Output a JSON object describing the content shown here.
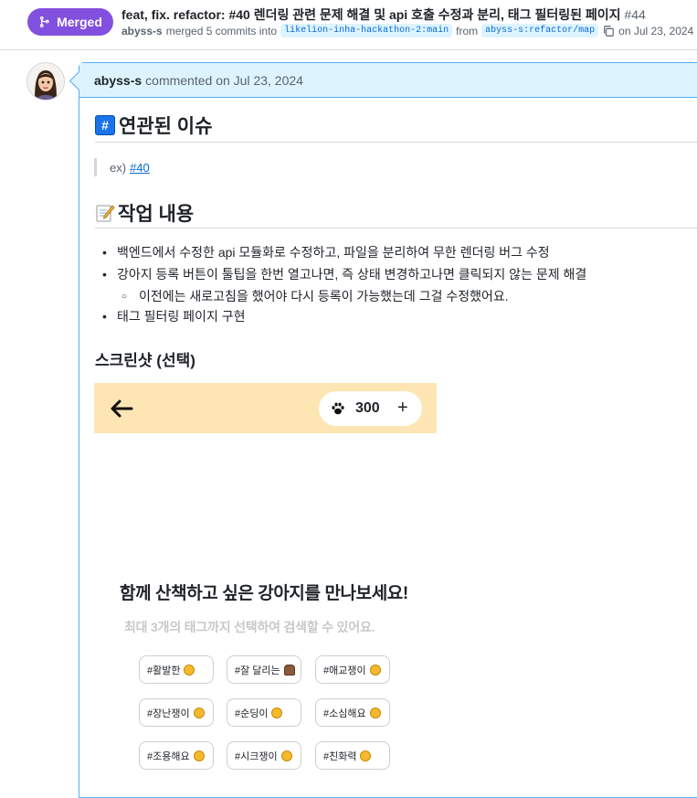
{
  "pr": {
    "status_label": "Merged",
    "title": "feat, fix. refactor: #40 렌더링 관련 문제 해결 및 api 호출 수정과 분리, 태그 필터링된 페이지",
    "number": "#44",
    "author": "abyss-s",
    "merged_text": "merged 5 commits into",
    "base_branch": "likelion-inha-hackathon-2:main",
    "from_text": "from",
    "head_branch": "abyss-s:refactor/map",
    "date": "on Jul 23, 2024",
    "accent": "#8250df"
  },
  "comment": {
    "author": "abyss-s",
    "meta": "commented on Jul 23, 2024",
    "related_heading": "연관된 이슈",
    "quote_prefix": "ex)",
    "quote_link": "#40",
    "work_heading": "작업 내용",
    "items": [
      "백엔드에서 수정한 api 모듈화로 수정하고, 파일을 분리하여 무한 렌더링 버그 수정",
      "강아지 등록 버튼이 툴팁을 한번 열고나면, 즉 상태 변경하고나면 클릭되지 않는 문제 해결",
      "이전에는 새로고침을 했어야 다시 등록이 가능했는데 그걸 수정했어요.",
      "태그 필터링 페이지 구현"
    ],
    "screenshot_heading": "스크린샷 (선택)"
  },
  "app_screenshot": {
    "points": "300",
    "title": "함께 산책하고 싶은 강아지를 만나보세요!",
    "subtitle": "최대 3개의 태그까지 선택하여 검색할 수 있어요.",
    "tags": [
      "#활발한",
      "#잘 달리는",
      "#애교쟁이",
      "#장난쟁이",
      "#순딩이",
      "#소심해요",
      "#조용해요",
      "#시크쟁이",
      "#친화력"
    ],
    "bar_color": "#fde6b3"
  }
}
